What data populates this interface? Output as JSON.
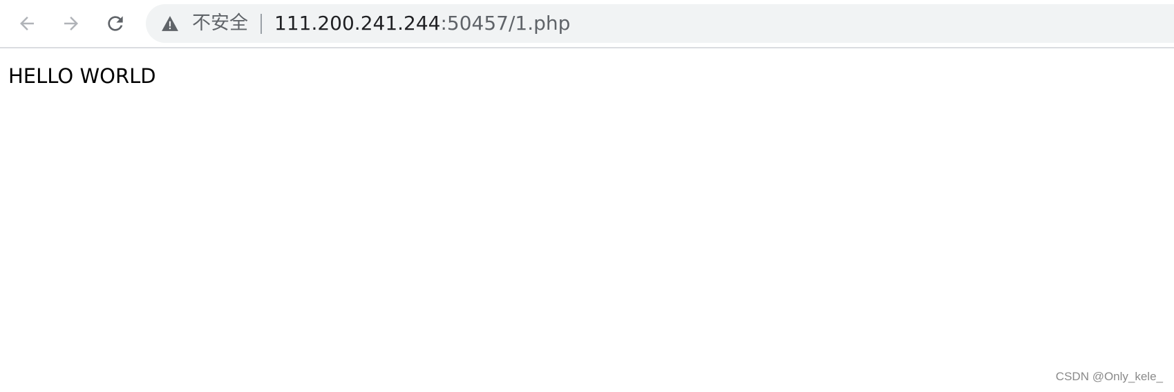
{
  "browser": {
    "security_label": "不安全",
    "url_host": "111.200.241.244",
    "url_rest": ":50457/1.php",
    "icons": {
      "back": "arrow-left-icon",
      "forward": "arrow-right-icon",
      "reload": "reload-icon",
      "security": "warning-icon"
    },
    "colors": {
      "omnibox_bg": "#f1f3f4",
      "url_host": "#202124",
      "url_rest": "#5f6368"
    }
  },
  "page": {
    "content_text": "HELLO WORLD"
  },
  "watermark": "CSDN @Only_kele_"
}
